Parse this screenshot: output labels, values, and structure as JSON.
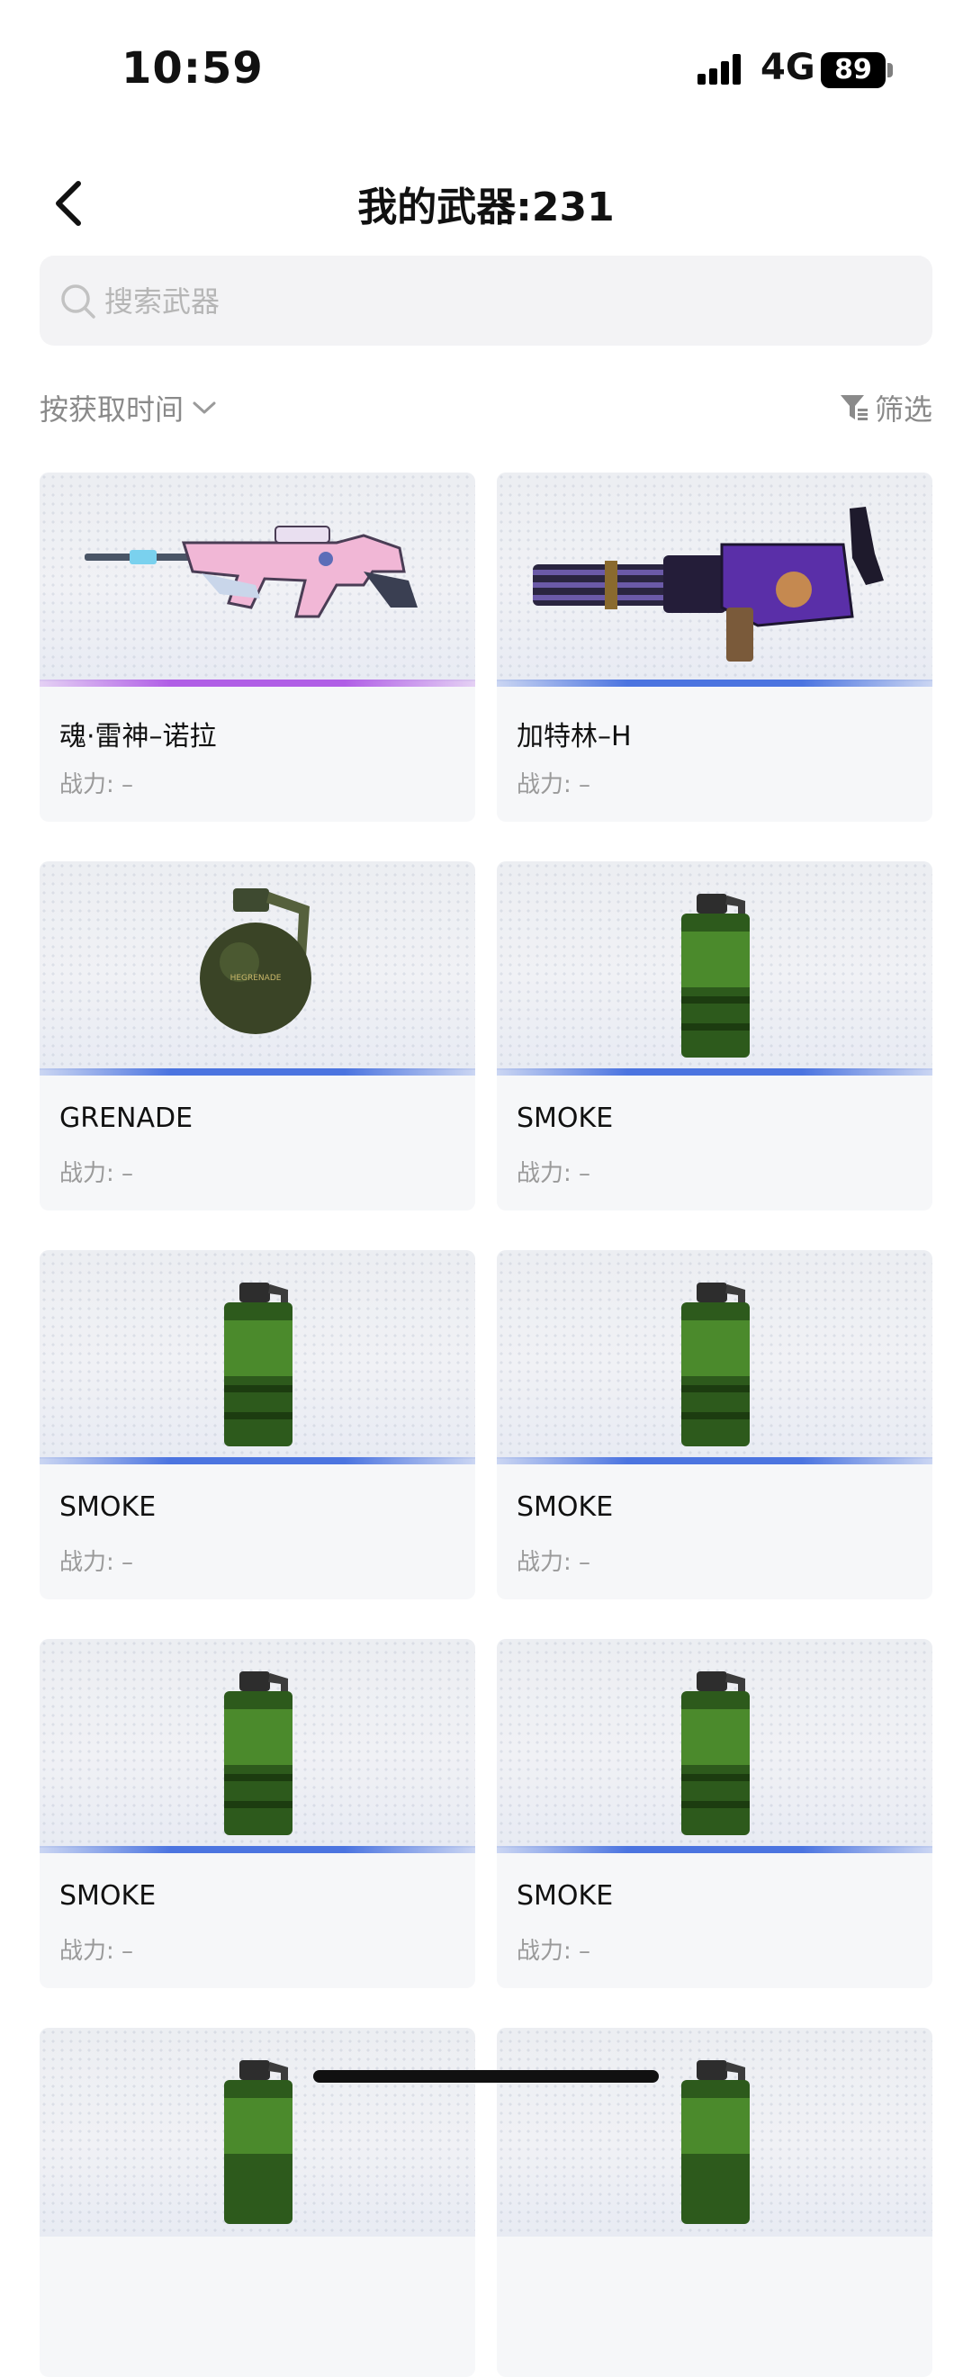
{
  "status": {
    "time": "10:59",
    "network": "4G",
    "battery": "89"
  },
  "header": {
    "title": "我的武器:231"
  },
  "search": {
    "placeholder": "搜索武器"
  },
  "toolbar": {
    "sort_label": "按获取时间",
    "filter_label": "筛选"
  },
  "colors": {
    "purple_bar": "#b05ee6",
    "blue_bar": "#4b74e0"
  },
  "weapons": [
    {
      "name": "魂·雷神–诺拉",
      "power": "战力: –",
      "icon": "pink-rifle-icon",
      "bar": "purple"
    },
    {
      "name": "加特林–H",
      "power": "战力: –",
      "icon": "gatling-gun-icon",
      "bar": "blue"
    },
    {
      "name": "GRENADE",
      "power": "战力: –",
      "icon": "grenade-icon",
      "bar": "blue"
    },
    {
      "name": "SMOKE",
      "power": "战力: –",
      "icon": "smoke-grenade-icon",
      "bar": "blue"
    },
    {
      "name": "SMOKE",
      "power": "战力: –",
      "icon": "smoke-grenade-icon",
      "bar": "blue"
    },
    {
      "name": "SMOKE",
      "power": "战力: –",
      "icon": "smoke-grenade-icon",
      "bar": "blue"
    },
    {
      "name": "SMOKE",
      "power": "战力: –",
      "icon": "smoke-grenade-icon",
      "bar": "blue"
    },
    {
      "name": "SMOKE",
      "power": "战力: –",
      "icon": "smoke-grenade-icon",
      "bar": "blue"
    },
    {
      "name": "",
      "power": "",
      "icon": "smoke-grenade-icon",
      "bar": "blue"
    },
    {
      "name": "",
      "power": "",
      "icon": "smoke-grenade-icon",
      "bar": "blue"
    }
  ]
}
